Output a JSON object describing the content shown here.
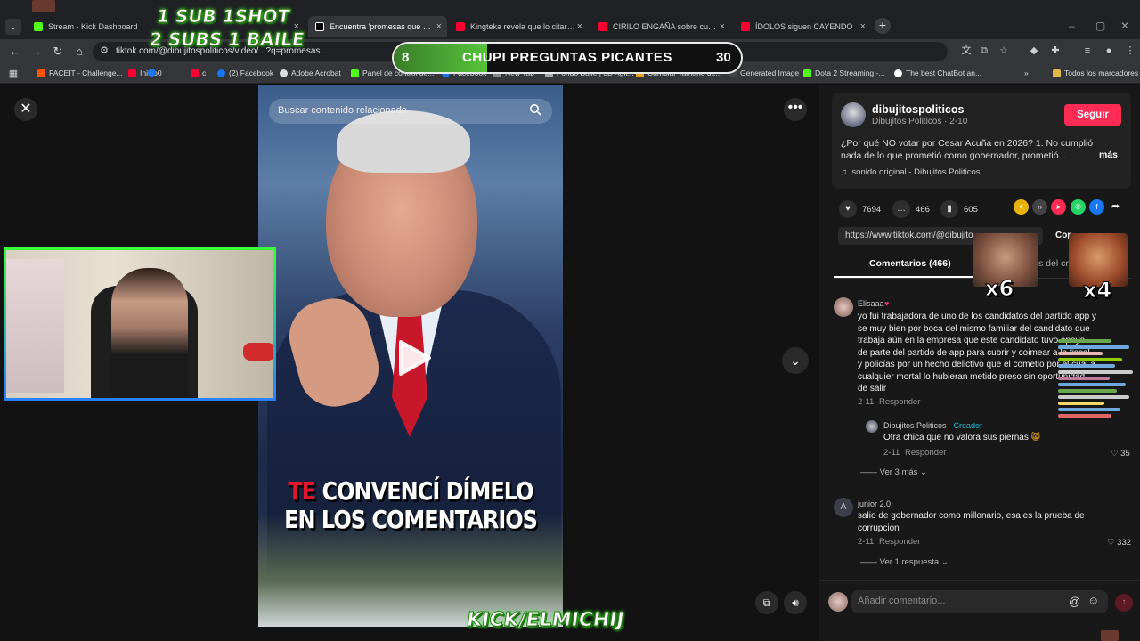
{
  "browser": {
    "tabs": [
      {
        "label": "Stream - Kick Dashboard",
        "color": "#53fc18"
      },
      {
        "label": "Encuentra 'promesas que no cu",
        "color": "#ffffff",
        "active": true
      },
      {
        "label": "Kingteka revela que lo citaron p",
        "color": "#ff0033"
      },
      {
        "label": "CIRILO ENGAÑA sobre cuanto",
        "color": "#ff0033"
      },
      {
        "label": "ÍDOLOS siguen CAYENDO",
        "color": "#ff0033"
      }
    ],
    "url": "tiktok.com/@dibujitospoliticos/video/...?q=promesas...",
    "bookmarks": [
      "FACEIT - Challenge...",
      "Inicio0",
      "c",
      "(2) Facebook",
      "Adobe Acrobat",
      "Panel de control de...",
      "Facebook",
      "New Tab",
      "Fondo Baile | 3D Agit...",
      "Cambiar Tamaño de...",
      "Generated Image",
      "Dota 2 Streaming -...",
      "The best ChatBot an...",
      "Todos los marcadores"
    ]
  },
  "video": {
    "search_placeholder": "Buscar contenido relacionado",
    "caption_red": "TE",
    "caption_line1_rest": " CONVENCÍ DÍMELO",
    "caption_line2": "EN LOS COMENTARIOS"
  },
  "author": {
    "name": "dibujitospoliticos",
    "subtitle": "Dibujitos Politicos · 2-10",
    "follow_label": "Seguir",
    "description": "¿Por qué NO votar por Cesar Acuña en 2026? 1. No cumplió nada de lo que prometió como gobernador, prometió...",
    "more_label": "más",
    "sound": "sonido original - Dibujitos Politicos"
  },
  "stats": {
    "likes": "7694",
    "comments": "466",
    "saves": "605"
  },
  "link": {
    "url": "https://www.tiktok.com/@dibujito",
    "copy_label": "Cop"
  },
  "comment_tabs": {
    "comments": "Comentarios (466)",
    "creator": "s del cre"
  },
  "comments": [
    {
      "user": "Elisaaa",
      "text": "yo fui trabajadora de uno de los candidatos del partido app y se muy bien por boca del mismo familiar del candidato que trabaja aún en la empresa que este candidato tuvo apoyo de parte del partido de app para cubrir y coimear a la fiscal y policías por un hecho delictivo que el cometio por el cual a cualquier mortal lo hubieran metido preso sin oportunidad de salir",
      "date": "2-11",
      "reply": "Responder"
    },
    {
      "user": "Dibujitos Politicos",
      "creator_tag": "· Creador",
      "text": "Otra chica que no valora sus piernas",
      "date": "2-11",
      "reply": "Responder",
      "likes": "35"
    },
    {
      "user": "junior 2.0",
      "text": "salio de gobernador como millonario, esa es la prueba de corrupcion",
      "date": "2-11",
      "reply": "Responder",
      "likes": "332"
    }
  ],
  "view_more": {
    "first": "Ver 3 más",
    "second": "Ver 1 respuesta"
  },
  "comment_input": {
    "placeholder": "Añadir comentario..."
  },
  "overlay": {
    "sub_line1": "1 SUB  1SHOT",
    "sub_line2": "2 SUBS 1 BAILE",
    "poll_left": "8",
    "poll_title": "CHUPI PREGUNTAS PICANTES",
    "poll_right": "30",
    "poll_progress": 0.27,
    "kick_tag": "KICK/ELMICHIJ",
    "emote1_count": "x6",
    "emote2_count": "x4"
  }
}
